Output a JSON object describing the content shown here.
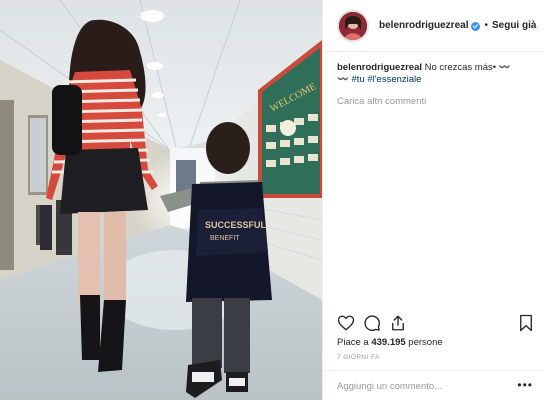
{
  "post": {
    "username": "belenrodriguezreal",
    "follow_label": "Segui già",
    "separator": "•",
    "caption_text": "No crezcas más• ",
    "caption_emoji_1": "〰️",
    "caption_hashtag_tu": "#tu",
    "caption_hashtag_essenziale": "#l'essenziale",
    "load_more": "Carica altri commenti",
    "likes_prefix": "Piace a ",
    "likes_count": "439.195",
    "likes_suffix": " persone",
    "time": "7 GIORNI FA",
    "comment_placeholder": "Aggiungi un commento...",
    "more_label": "•••"
  },
  "photo": {
    "board_title": "WELCOME",
    "backpack_text_1": "SUCCESSFUL",
    "backpack_text_2": "BENEFIT"
  },
  "icons": {
    "heart": "heart-icon",
    "comment": "comment-icon",
    "share": "share-icon",
    "bookmark": "bookmark-icon",
    "verified": "verified-badge-icon"
  },
  "colors": {
    "link_blue": "#3897f0",
    "hashtag": "#003569",
    "muted": "#999999",
    "text": "#262626"
  }
}
